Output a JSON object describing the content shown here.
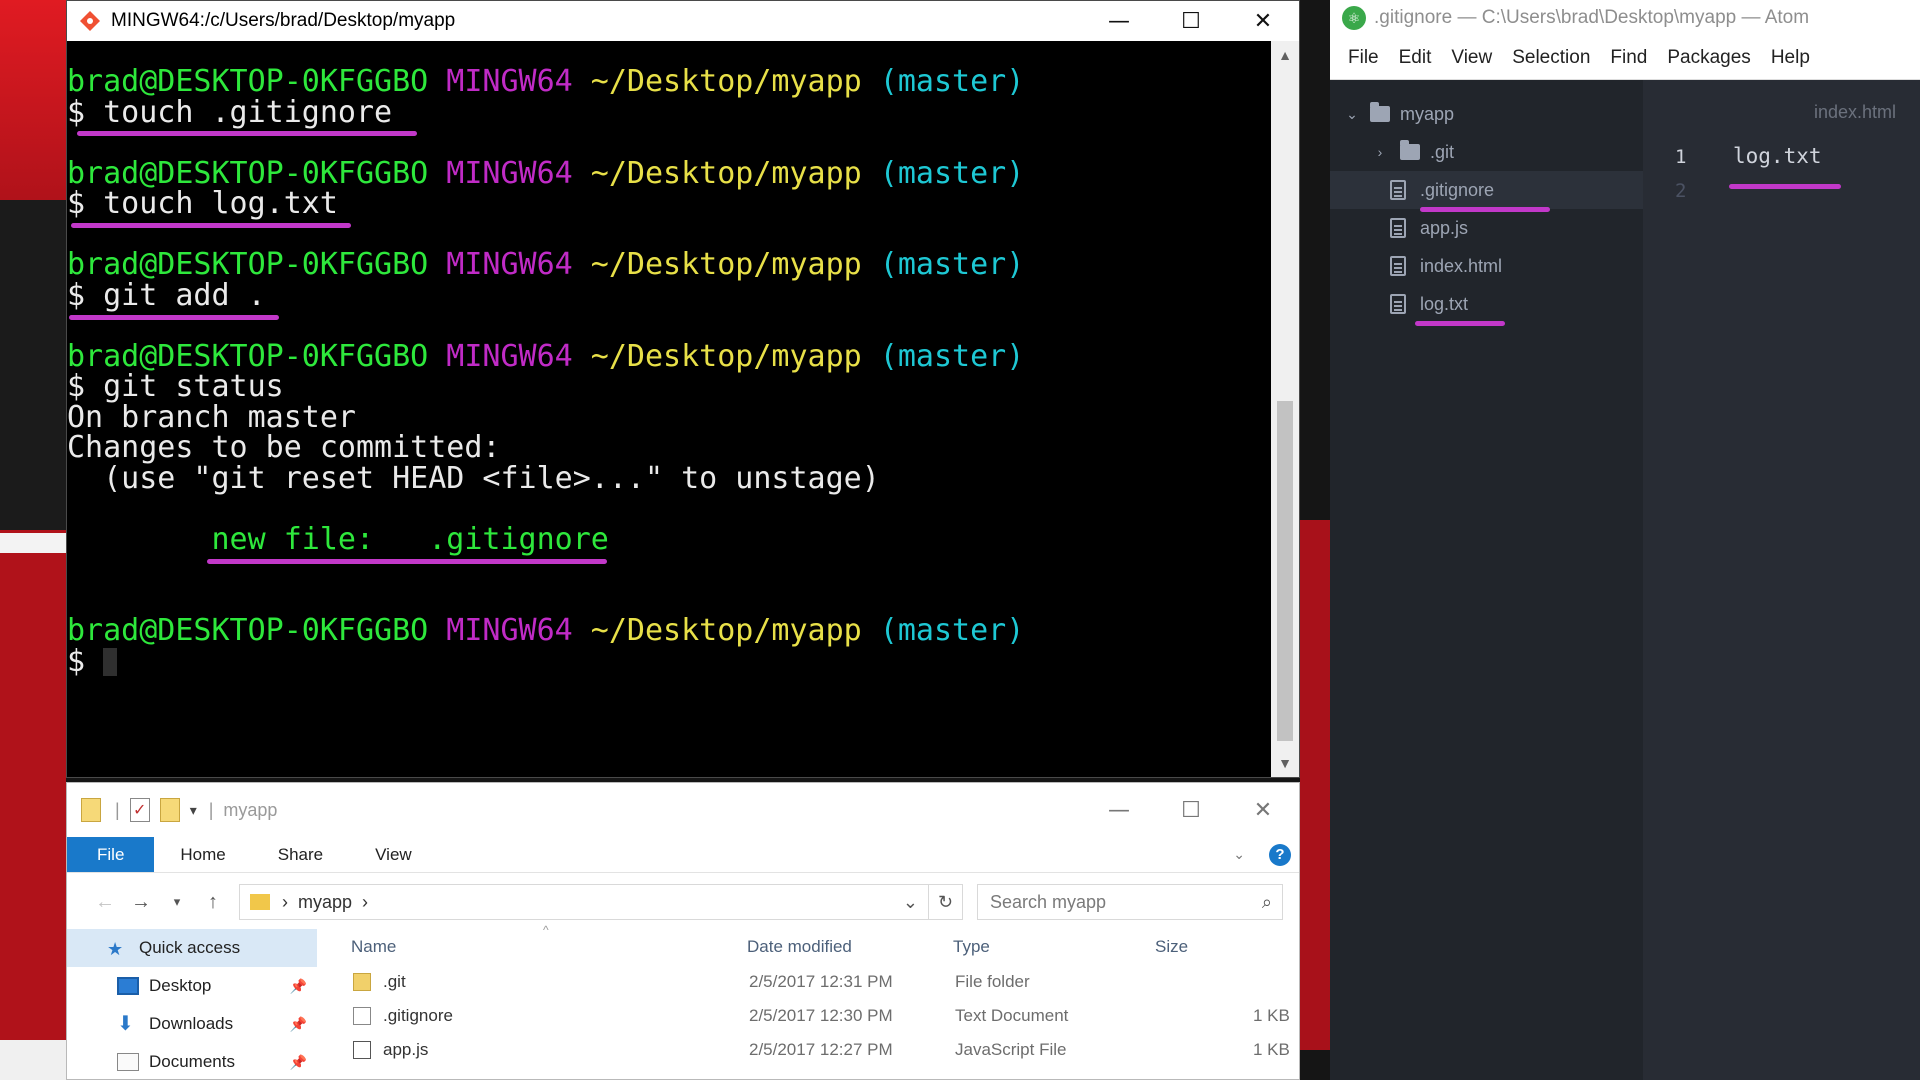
{
  "terminal": {
    "title": "MINGW64:/c/Users/brad/Desktop/myapp",
    "prompt": {
      "user_host": "brad@DESKTOP-0KFGGBO",
      "shell": "MINGW64",
      "path": "~/Desktop/myapp",
      "branch": "(master)"
    },
    "commands": [
      "$ touch .gitignore",
      "$ touch log.txt",
      "$ git add .",
      "$ git status"
    ],
    "output": {
      "line1": "On branch master",
      "line2": "Changes to be committed:",
      "line3": "  (use \"git reset HEAD <file>...\" to unstage)",
      "new_file_label": "new file:",
      "new_file_name": ".gitignore"
    },
    "final_prompt_symbol": "$",
    "colors": {
      "user_host": "#2ee83c",
      "shell": "#c02bc6",
      "path": "#e8e048",
      "branch": "#1ec8d4",
      "annotation": "#c238c9"
    }
  },
  "atom": {
    "title": ".gitignore — C:\\Users\\brad\\Desktop\\myapp — Atom",
    "menu": [
      "File",
      "Edit",
      "View",
      "Selection",
      "Find",
      "Packages",
      "Help"
    ],
    "tree": {
      "root": "myapp",
      "items": [
        {
          "name": ".git",
          "kind": "folder"
        },
        {
          "name": ".gitignore",
          "kind": "file"
        },
        {
          "name": "app.js",
          "kind": "file"
        },
        {
          "name": "index.html",
          "kind": "file"
        },
        {
          "name": "log.txt",
          "kind": "file"
        }
      ]
    },
    "tab": "index.html",
    "editor": {
      "lines": [
        {
          "num": "1",
          "text": "log.txt"
        },
        {
          "num": "2",
          "text": ""
        }
      ]
    }
  },
  "explorer": {
    "title": "myapp",
    "ribbon_tabs": [
      "File",
      "Home",
      "Share",
      "View"
    ],
    "address": {
      "crumb": "myapp",
      "sep": "›"
    },
    "search_placeholder": "Search myapp",
    "nav": [
      {
        "label": "Quick access",
        "icon": "star-icon"
      },
      {
        "label": "Desktop",
        "icon": "desktop-icon"
      },
      {
        "label": "Downloads",
        "icon": "download-icon"
      },
      {
        "label": "Documents",
        "icon": "documents-icon"
      }
    ],
    "columns": [
      "Name",
      "Date modified",
      "Type",
      "Size"
    ],
    "rows": [
      {
        "name": ".git",
        "date": "2/5/2017 12:31 PM",
        "type": "File folder",
        "size": ""
      },
      {
        "name": ".gitignore",
        "date": "2/5/2017 12:30 PM",
        "type": "Text Document",
        "size": "1 KB"
      },
      {
        "name": "app.js",
        "date": "2/5/2017 12:27 PM",
        "type": "JavaScript File",
        "size": "1 KB"
      }
    ]
  }
}
